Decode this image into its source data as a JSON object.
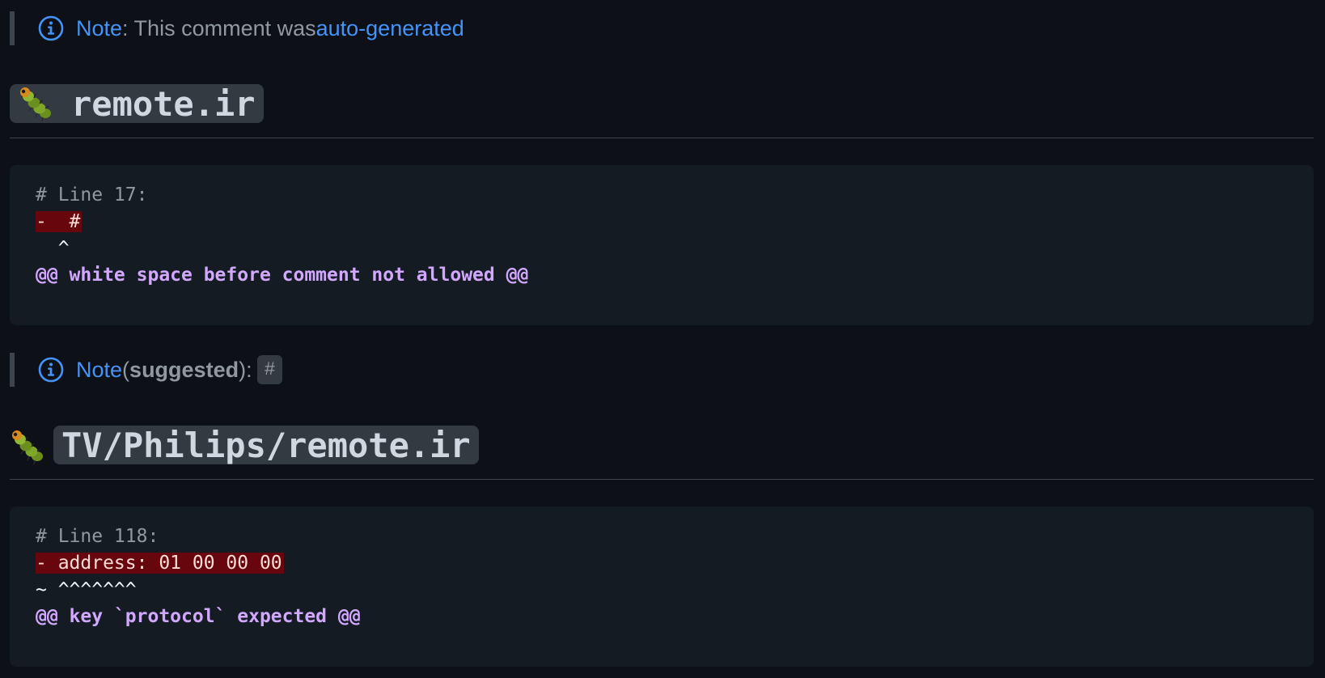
{
  "note1": {
    "label": "Note",
    "text": ": This comment was ",
    "link": "auto-generated"
  },
  "file1": {
    "icon": "caterpillar-bug-icon",
    "title": "remote.ir",
    "code": {
      "comment": "# Line 17:",
      "deleted": "-  #",
      "marker": "  ^",
      "message": "@@ white space before comment not allowed @@"
    }
  },
  "note2": {
    "label": "Note",
    "paren_open": "(",
    "suggested": "suggested",
    "paren_close": "):",
    "code": "#"
  },
  "file2": {
    "icon": "caterpillar-bug-icon",
    "title": "TV/Philips/remote.ir",
    "code": {
      "comment": "# Line 118:",
      "deleted": "- address: 01 00 00 00",
      "marker": "~ ^^^^^^^",
      "message": "@@ key `protocol` expected @@"
    }
  },
  "colors": {
    "background": "#0d1117",
    "accent_blue": "#4493f8",
    "deleted_bg": "#67060c",
    "meta_purple": "#d2a8ff"
  }
}
